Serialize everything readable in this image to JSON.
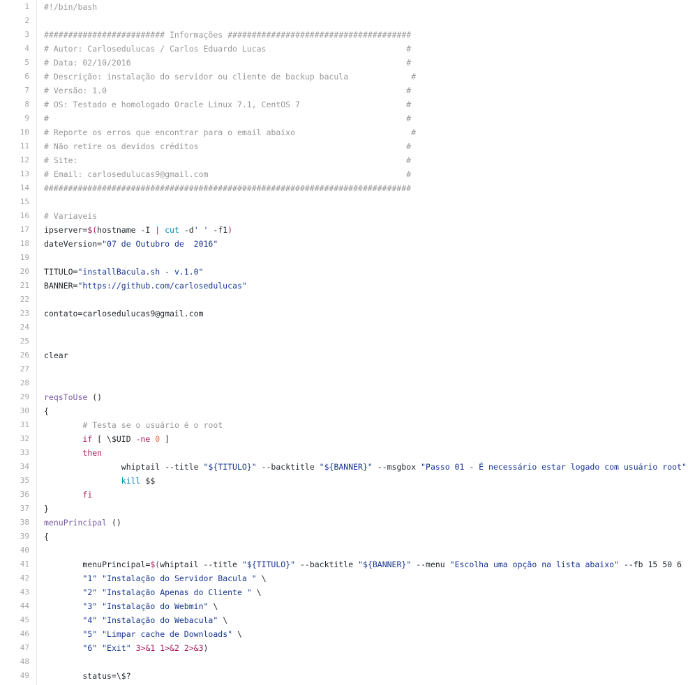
{
  "colors": {
    "comment": "#969896",
    "string": "#183691",
    "keyword": "#a71d5d",
    "function": "#795da3",
    "builtin": "#0086b3",
    "number": "#ed6a43",
    "text": "#24292e",
    "line_number": "#a6a6a6"
  },
  "lines": [
    {
      "n": "1",
      "tokens": [
        [
          "c",
          "#!/bin/bash"
        ]
      ]
    },
    {
      "n": "2",
      "tokens": []
    },
    {
      "n": "3",
      "tokens": [
        [
          "c",
          "######################### Informações ######################################"
        ]
      ]
    },
    {
      "n": "4",
      "tokens": [
        [
          "c",
          "# Autor: Carlosedulucas / Carlos Eduardo Lucas                             #"
        ]
      ]
    },
    {
      "n": "5",
      "tokens": [
        [
          "c",
          "# Data: 02/10/2016                                                         #"
        ]
      ]
    },
    {
      "n": "6",
      "tokens": [
        [
          "c",
          "# Descrição: instalação do servidor ou cliente de backup bacula             #"
        ]
      ]
    },
    {
      "n": "7",
      "tokens": [
        [
          "c",
          "# Versão: 1.0                                                              #"
        ]
      ]
    },
    {
      "n": "8",
      "tokens": [
        [
          "c",
          "# OS: Testado e homologado Oracle Linux 7.1, CentOS 7                      #"
        ]
      ]
    },
    {
      "n": "9",
      "tokens": [
        [
          "c",
          "#                                                                          #"
        ]
      ]
    },
    {
      "n": "10",
      "tokens": [
        [
          "c",
          "# Reporte os erros que encontrar para o email abaixo                        #"
        ]
      ]
    },
    {
      "n": "11",
      "tokens": [
        [
          "c",
          "# Não retire os devidos créditos                                           #"
        ]
      ]
    },
    {
      "n": "12",
      "tokens": [
        [
          "c",
          "# Site:                                                                    #"
        ]
      ]
    },
    {
      "n": "13",
      "tokens": [
        [
          "c",
          "# Email: carlosedulucas9@gmail.com                                         #"
        ]
      ]
    },
    {
      "n": "14",
      "tokens": [
        [
          "c",
          "############################################################################"
        ]
      ]
    },
    {
      "n": "15",
      "tokens": []
    },
    {
      "n": "16",
      "tokens": [
        [
          "c",
          "# Variaveis"
        ]
      ]
    },
    {
      "n": "17",
      "tokens": [
        [
          "",
          "ipserver="
        ],
        [
          "k",
          "$("
        ],
        [
          "",
          "hostname -I "
        ],
        [
          "k",
          "|"
        ],
        [
          "",
          ""
        ],
        [
          "n",
          " cut"
        ],
        [
          "",
          " -d"
        ],
        [
          "s",
          "' '"
        ],
        [
          "",
          " -f1"
        ],
        [
          "k",
          ")"
        ]
      ]
    },
    {
      "n": "18",
      "tokens": [
        [
          "",
          "dateVersion="
        ],
        [
          "s",
          "\"07 de Outubro de  2016\""
        ]
      ]
    },
    {
      "n": "19",
      "tokens": []
    },
    {
      "n": "20",
      "tokens": [
        [
          "",
          "TITULO="
        ],
        [
          "s",
          "\"installBacula.sh - v.1.0\""
        ]
      ]
    },
    {
      "n": "21",
      "tokens": [
        [
          "",
          "BANNER="
        ],
        [
          "s",
          "\"https://github.com/carlosedulucas\""
        ]
      ]
    },
    {
      "n": "22",
      "tokens": []
    },
    {
      "n": "23",
      "tokens": [
        [
          "",
          "contato=carlosedulucas9@gmail.com"
        ]
      ]
    },
    {
      "n": "24",
      "tokens": []
    },
    {
      "n": "25",
      "tokens": []
    },
    {
      "n": "26",
      "tokens": [
        [
          "",
          "clear"
        ]
      ]
    },
    {
      "n": "27",
      "tokens": []
    },
    {
      "n": "28",
      "tokens": []
    },
    {
      "n": "29",
      "tokens": [
        [
          "f",
          "reqsToUse"
        ],
        [
          "",
          " ()"
        ]
      ]
    },
    {
      "n": "30",
      "tokens": [
        [
          "",
          "{"
        ]
      ]
    },
    {
      "n": "31",
      "tokens": [
        [
          "",
          "        "
        ],
        [
          "c",
          "# Testa se o usuário é o root"
        ]
      ]
    },
    {
      "n": "32",
      "tokens": [
        [
          "",
          "        "
        ],
        [
          "k",
          "if"
        ],
        [
          "",
          " [ \\$UID "
        ],
        [
          "k",
          "-ne"
        ],
        [
          "",
          " "
        ],
        [
          "v",
          "0"
        ],
        [
          "",
          " ]"
        ]
      ]
    },
    {
      "n": "33",
      "tokens": [
        [
          "",
          "        "
        ],
        [
          "k",
          "then"
        ]
      ]
    },
    {
      "n": "34",
      "tokens": [
        [
          "",
          "                whiptail --title "
        ],
        [
          "s",
          "\"${TITULO}\""
        ],
        [
          "",
          " --backtitle "
        ],
        [
          "s",
          "\"${BANNER}\""
        ],
        [
          "",
          " --msgbox "
        ],
        [
          "s",
          "\"Passo 01 - É necessário estar logado com usuário root\""
        ]
      ]
    },
    {
      "n": "35",
      "tokens": [
        [
          "",
          "                "
        ],
        [
          "n",
          "kill"
        ],
        [
          "",
          " $$"
        ]
      ]
    },
    {
      "n": "36",
      "tokens": [
        [
          "",
          "        "
        ],
        [
          "k",
          "fi"
        ]
      ]
    },
    {
      "n": "37",
      "tokens": [
        [
          "",
          "}"
        ]
      ]
    },
    {
      "n": "38",
      "tokens": [
        [
          "f",
          "menuPrincipal"
        ],
        [
          "",
          " ()"
        ]
      ]
    },
    {
      "n": "39",
      "tokens": [
        [
          "",
          "{"
        ]
      ]
    },
    {
      "n": "40",
      "tokens": []
    },
    {
      "n": "41",
      "tokens": [
        [
          "",
          "        menuPrincipal="
        ],
        [
          "k",
          "$("
        ],
        [
          "",
          "whiptail --title "
        ],
        [
          "s",
          "\"${TITULO}\""
        ],
        [
          "",
          " --backtitle "
        ],
        [
          "s",
          "\"${BANNER}\""
        ],
        [
          "",
          " --menu "
        ],
        [
          "s",
          "\"Escolha uma opção na lista abaixo\""
        ],
        [
          "",
          " --fb 15 50 6"
        ]
      ]
    },
    {
      "n": "42",
      "tokens": [
        [
          "",
          "        "
        ],
        [
          "s",
          "\"1\""
        ],
        [
          "",
          " "
        ],
        [
          "s",
          "\"Instalação do Servidor Bacula \""
        ],
        [
          "",
          " \\"
        ]
      ]
    },
    {
      "n": "43",
      "tokens": [
        [
          "",
          "        "
        ],
        [
          "s",
          "\"2\""
        ],
        [
          "",
          " "
        ],
        [
          "s",
          "\"Instalação Apenas do Cliente \""
        ],
        [
          "",
          " \\"
        ]
      ]
    },
    {
      "n": "44",
      "tokens": [
        [
          "",
          "        "
        ],
        [
          "s",
          "\"3\""
        ],
        [
          "",
          " "
        ],
        [
          "s",
          "\"Instalação do Webmin\""
        ],
        [
          "",
          " \\"
        ]
      ]
    },
    {
      "n": "45",
      "tokens": [
        [
          "",
          "        "
        ],
        [
          "s",
          "\"4\""
        ],
        [
          "",
          " "
        ],
        [
          "s",
          "\"Instalação do Webacula\""
        ],
        [
          "",
          " \\"
        ]
      ]
    },
    {
      "n": "46",
      "tokens": [
        [
          "",
          "        "
        ],
        [
          "s",
          "\"5\""
        ],
        [
          "",
          " "
        ],
        [
          "s",
          "\"Limpar cache de Downloads\""
        ],
        [
          "",
          " \\"
        ]
      ]
    },
    {
      "n": "47",
      "tokens": [
        [
          "",
          "        "
        ],
        [
          "s",
          "\"6\""
        ],
        [
          "",
          " "
        ],
        [
          "s",
          "\"Exit\""
        ],
        [
          "",
          " "
        ],
        [
          "k",
          "3>&1 1>&2 2>&3"
        ],
        [
          "",
          ")"
        ]
      ]
    },
    {
      "n": "48",
      "tokens": []
    },
    {
      "n": "49",
      "tokens": [
        [
          "",
          "        status=\\$?"
        ]
      ]
    }
  ]
}
